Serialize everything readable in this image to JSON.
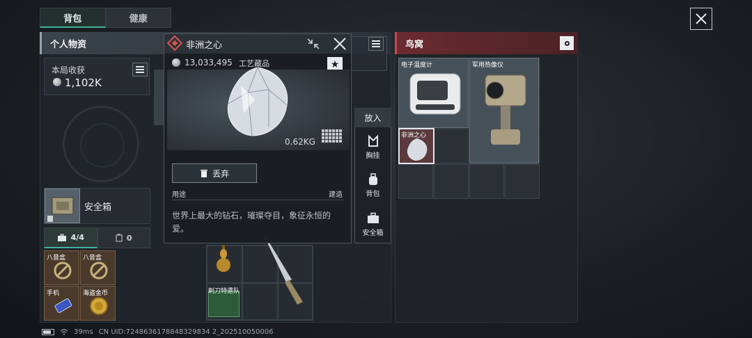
{
  "tabs": {
    "backpack": "背包",
    "health": "健康"
  },
  "left_panel": {
    "title": "个人物资",
    "harvest_label": "本局收获",
    "harvest_value": "1,102K",
    "safe_box_label": "安全箱",
    "subtab_case_count": "4/4",
    "subtab_other_count": "0",
    "case_items": [
      {
        "label": "八音盒"
      },
      {
        "label": "八音盒"
      },
      {
        "label": "手机"
      },
      {
        "label": "海盗金币"
      }
    ]
  },
  "mid_items": {
    "knife_label": "刺刀特遣队"
  },
  "popup": {
    "title": "非洲之心",
    "price": "13,033,495",
    "category": "工艺藏品",
    "weight": "0.62KG",
    "discard_label": "丢弃",
    "use_label": "用途",
    "build_label": "建造",
    "description": "世界上最大的钻石，璀璨夺目，象征永恒的爱。"
  },
  "put_in": {
    "title": "放入",
    "items": [
      "胸挂",
      "背包",
      "安全箱"
    ]
  },
  "right_panel": {
    "title": "鸟窝",
    "items": {
      "a": "电子温度计",
      "b": "军用热像仪",
      "c": "非洲之心"
    }
  },
  "status_bar": {
    "ping": "39ms",
    "uid": "CN UID:7248636178848329834 2_202510050006"
  },
  "colors": {
    "accent": "#3fb39c",
    "danger": "#c64a52",
    "gem_red": "#d9534f"
  }
}
